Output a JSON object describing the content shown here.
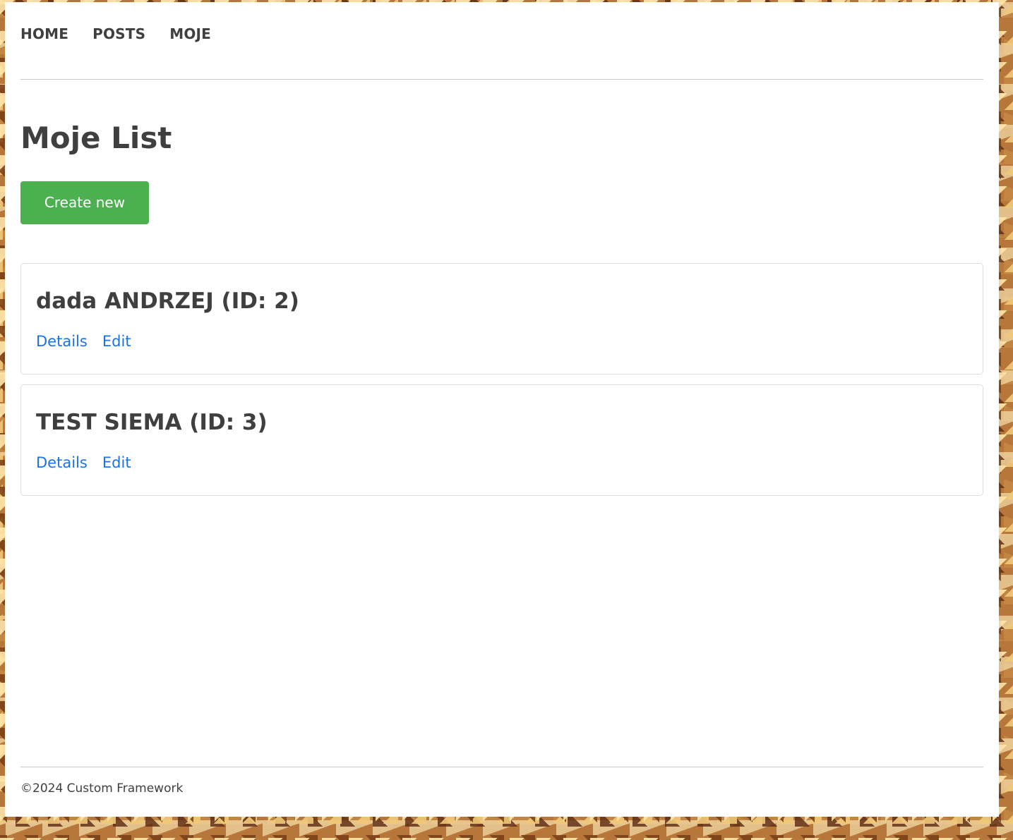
{
  "nav": {
    "items": [
      {
        "label": "HOME"
      },
      {
        "label": "POSTS"
      },
      {
        "label": "MOJE"
      }
    ]
  },
  "page": {
    "title": "Moje List",
    "create_button_label": "Create new"
  },
  "list": {
    "items": [
      {
        "title": "dada ANDRZEJ (ID: 2)",
        "details_label": "Details",
        "edit_label": "Edit"
      },
      {
        "title": "TEST SIEMA (ID: 3)",
        "details_label": "Details",
        "edit_label": "Edit"
      }
    ]
  },
  "footer": {
    "text": "©2024 Custom Framework"
  },
  "colors": {
    "accent_green": "#4caf50",
    "link_blue": "#1a73e8",
    "text": "#3f3f3f"
  }
}
